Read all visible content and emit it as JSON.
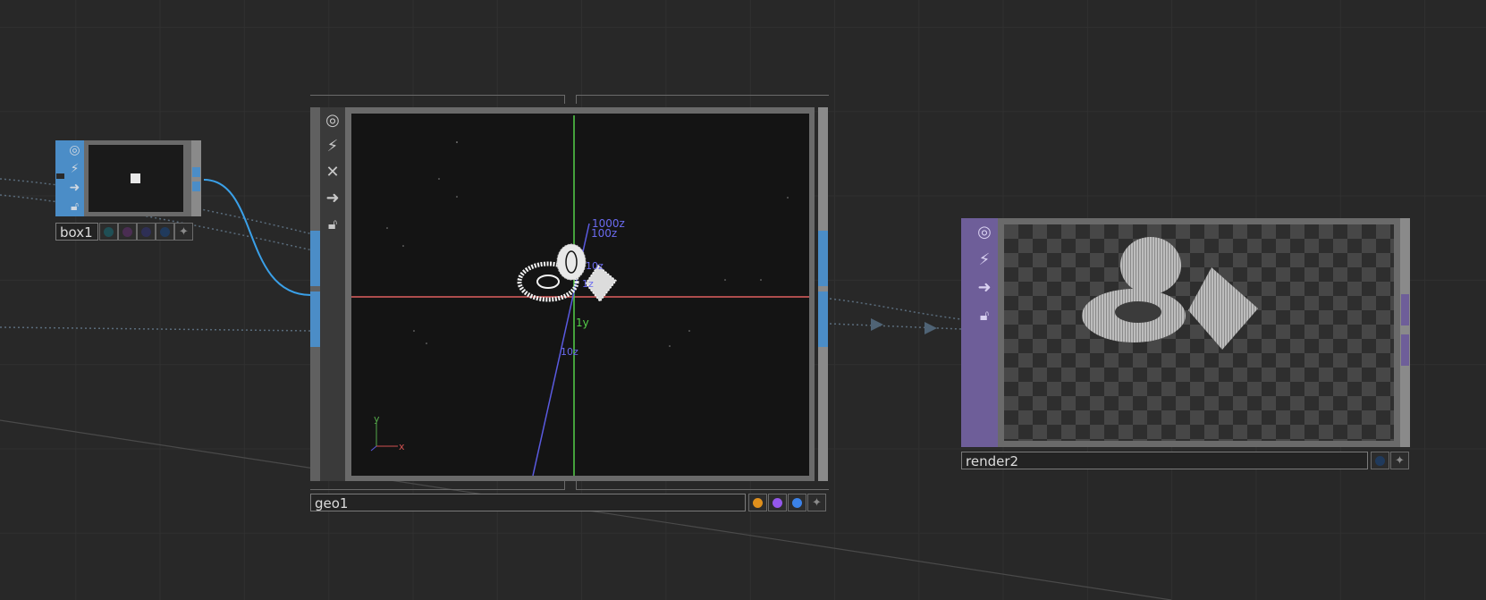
{
  "nodes": {
    "box1": {
      "name": "box1",
      "flag_icons": [
        "display-flag-icon",
        "bypass-flag-icon",
        "render-flag-icon",
        "lock-flag-icon"
      ]
    },
    "geo1": {
      "name": "geo1",
      "viewport_labels": {
        "z1000": "1000z",
        "z100": "100z",
        "z10": "10z",
        "z1": "1z",
        "y1": "1y",
        "z10neg": "10z",
        "ax_y": "y",
        "ax_x": "x"
      }
    },
    "render2": {
      "name": "render2"
    }
  },
  "colors": {
    "canvas_bg": "#282828",
    "wire_blue": "#3aa0e8",
    "wire_dotted": "#4b6072",
    "sop_blue": "#4b8dc7",
    "comp_purple": "#6e5e99",
    "geo_orange": "#e0901c",
    "geo_purple": "#9457eb",
    "geo_blue": "#3b82e8"
  }
}
